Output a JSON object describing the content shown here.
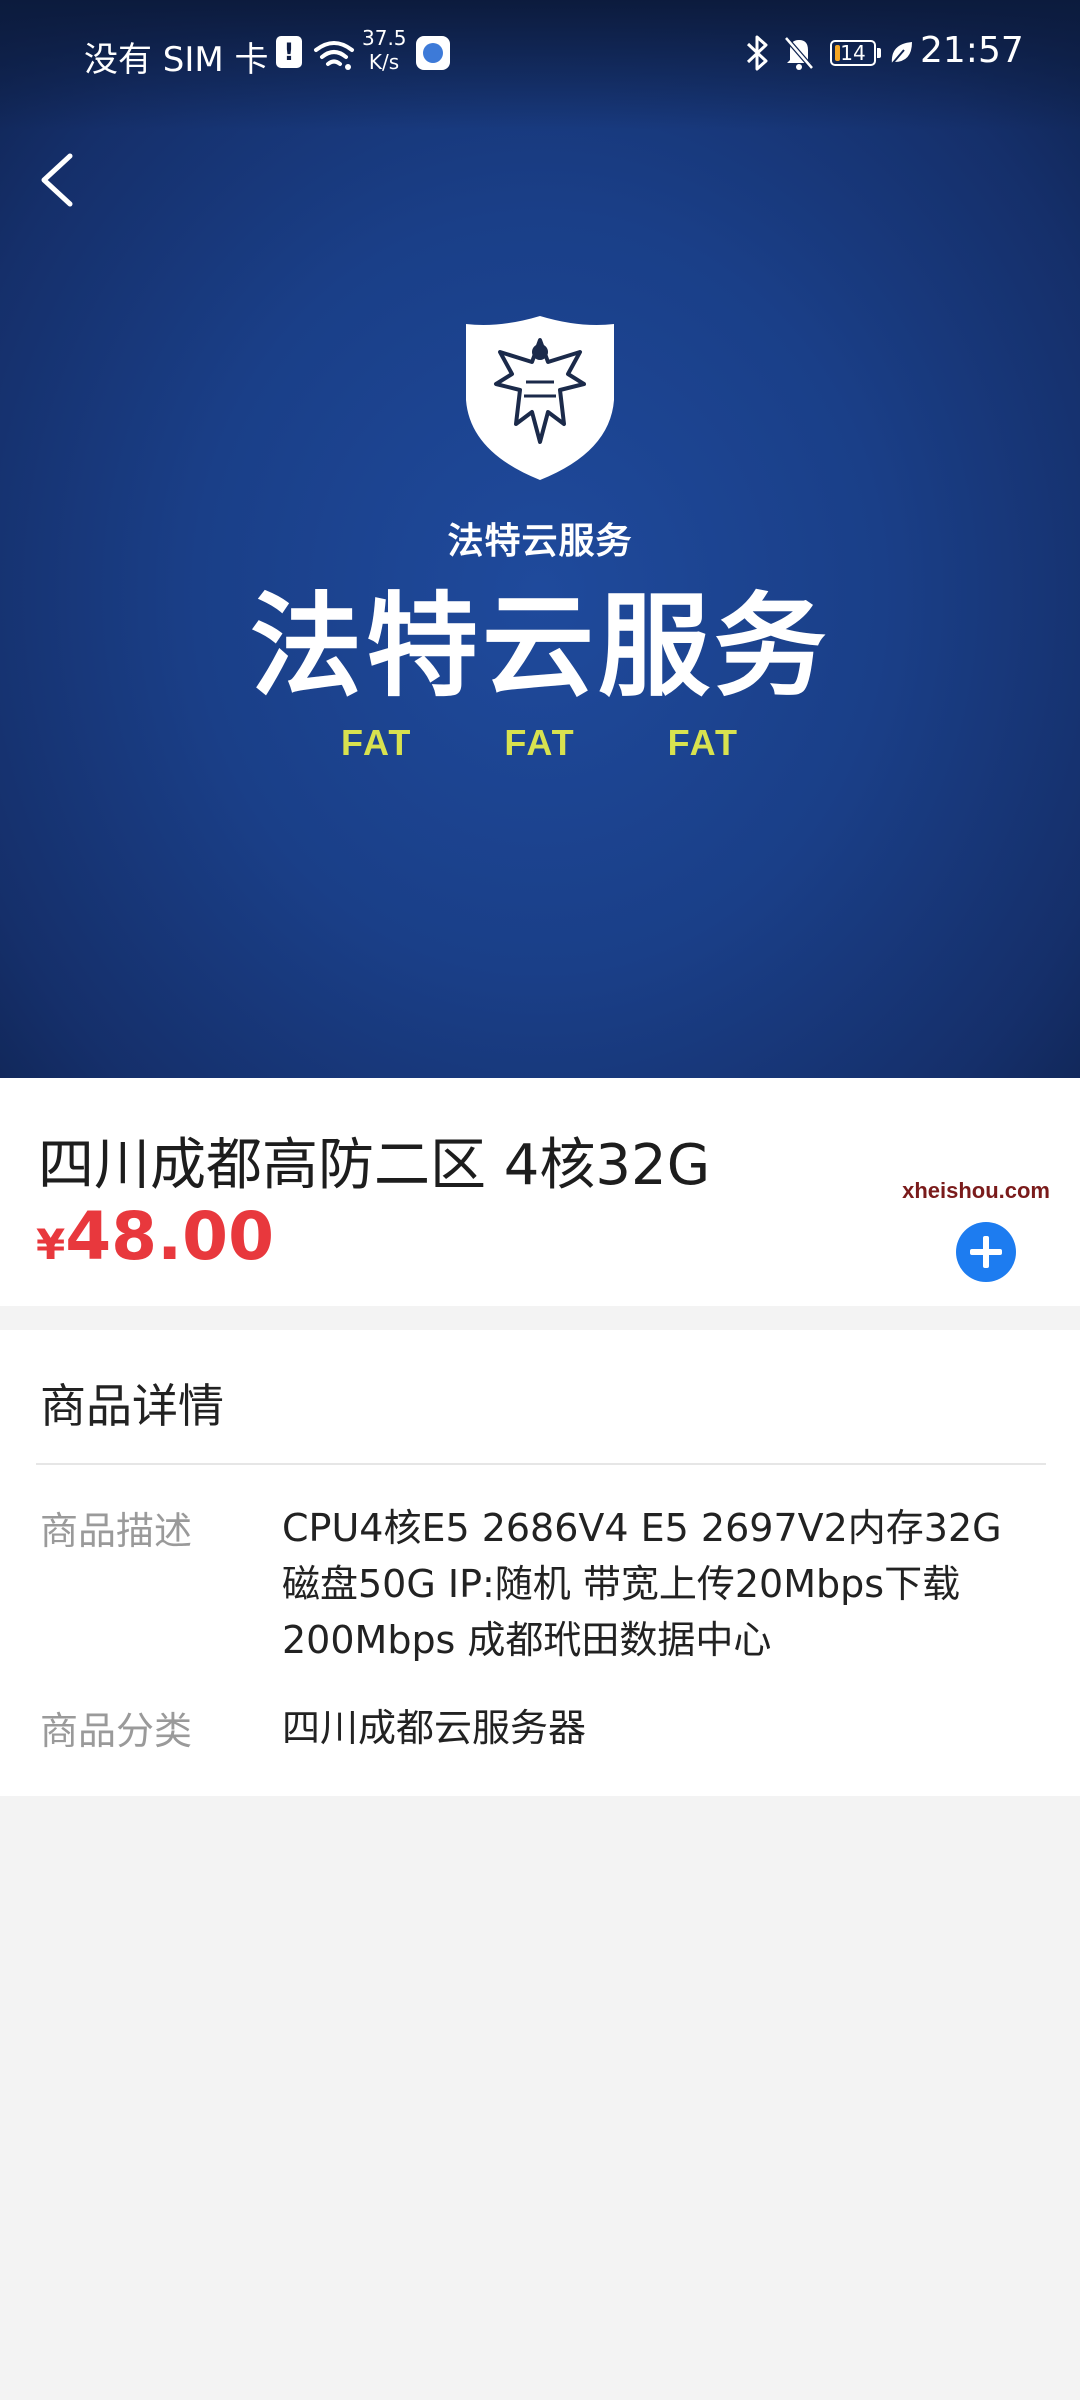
{
  "status_bar": {
    "carrier": "没有 SIM 卡",
    "sim_alert": "!",
    "net_speed_value": "37.5",
    "net_speed_unit": "K/s",
    "battery_level": "14",
    "battery_fraction": 0.14,
    "battery_color": "#f5a623",
    "time": "21:57"
  },
  "banner": {
    "logo_subtitle": "法特云服务",
    "logo_title": "法特云服务",
    "logo_tags": [
      "FAT",
      "FAT",
      "FAT"
    ],
    "background_color": "#1a3f88"
  },
  "product": {
    "name": "四川成都高防二区 4核32G",
    "price_symbol": "¥",
    "price_value": "48.00",
    "price_color": "#e8383d",
    "watermark": "xheishou.com"
  },
  "details": {
    "heading": "商品详情",
    "description_label": "商品描述",
    "description_value": "CPU4核E5 2686V4 E5 2697V2内存32G 磁盘50G IP:随机 带宽上传20Mbps下载200Mbps 成都玳田数据中心",
    "category_label": "商品分类",
    "category_value": "四川成都云服务器"
  },
  "icons": {
    "back": "chevron-left-icon",
    "add": "plus-circle-icon",
    "wifi": "wifi-icon",
    "bluetooth": "bluetooth-icon",
    "mute": "bell-off-icon",
    "battery": "battery-icon",
    "leaf": "leaf-icon",
    "logo": "eagle-shield-icon"
  },
  "accent_color": "#1d7cf0"
}
